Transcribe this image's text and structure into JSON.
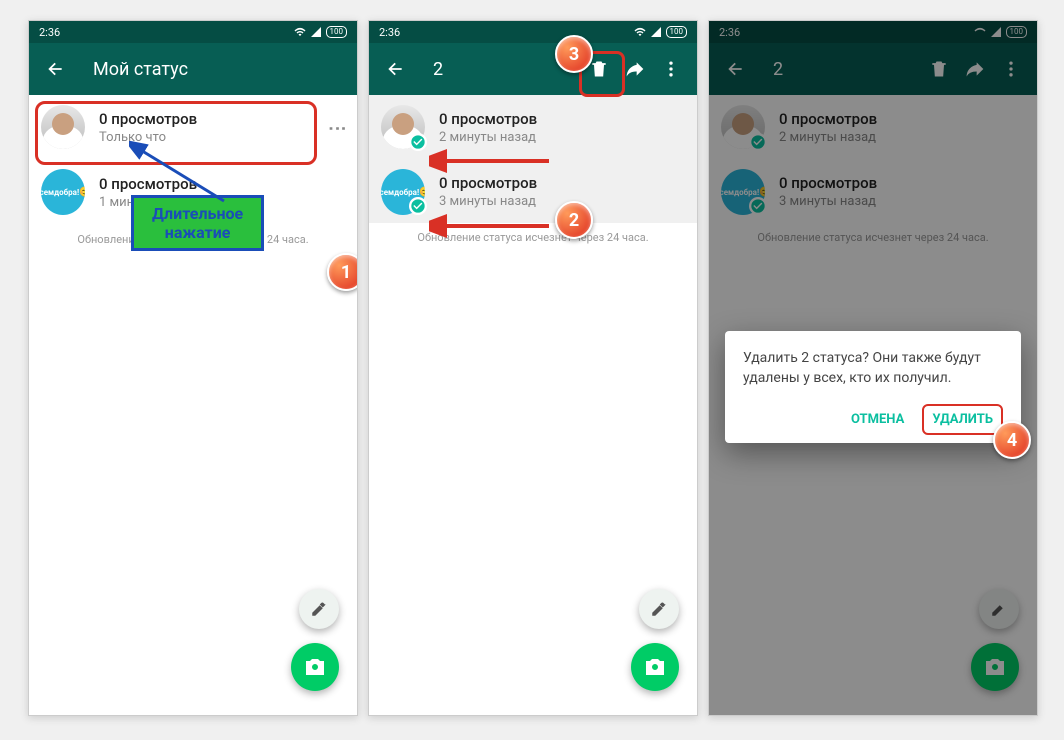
{
  "statusbar": {
    "time": "2:36",
    "battery": "100"
  },
  "screen1": {
    "title": "Мой статус",
    "items": [
      {
        "views": "0 просмотров",
        "time": "Только что"
      },
      {
        "views": "0 просмотров",
        "time": "1 минуту назад"
      }
    ],
    "footer": "Обновление статуса исчезнет через 24 часа.",
    "tooltip": "Длительное\nнажатие"
  },
  "screen2": {
    "selected": "2",
    "items": [
      {
        "views": "0 просмотров",
        "time": "2 минуты назад"
      },
      {
        "views": "0 просмотров",
        "time": "3 минуты назад"
      }
    ],
    "footer": "Обновление статуса исчезнет через 24 часа."
  },
  "screen3": {
    "selected": "2",
    "items": [
      {
        "views": "0 просмотров",
        "time": "2 минуты назад"
      },
      {
        "views": "0 просмотров",
        "time": "3 минуты назад"
      }
    ],
    "footer": "Обновление статуса исчезнет через 24 часа.",
    "dialog": {
      "message": "Удалить 2 статуса? Они также будут удалены у всех, кто их получил.",
      "cancel": "ОТМЕНА",
      "delete": "УДАЛИТЬ"
    }
  },
  "avatar_blue": {
    "line1": "Всем",
    "line2": "добра!"
  },
  "steps": {
    "s1": "1",
    "s2": "2",
    "s3": "3",
    "s4": "4"
  }
}
